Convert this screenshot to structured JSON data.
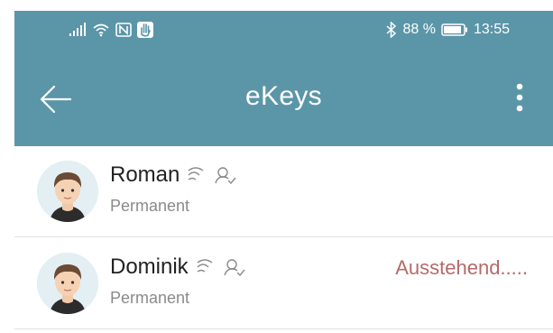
{
  "status_bar": {
    "battery_percent": "88 %",
    "time": "13:55",
    "icons": [
      "signal-icon",
      "wifi-icon",
      "nfc-icon",
      "hand-icon",
      "bluetooth-icon",
      "battery-icon"
    ]
  },
  "app_bar": {
    "title": "eKeys",
    "back_icon": "arrow-left-icon",
    "menu_icon": "more-vertical-icon",
    "color": "#5b96a8"
  },
  "keys": [
    {
      "name": "Roman",
      "type": "Permanent",
      "status": ""
    },
    {
      "name": "Dominik",
      "type": "Permanent",
      "status": "Ausstehend....."
    }
  ],
  "colors": {
    "pending": "#b56a6a",
    "subtext": "#8a8a8a"
  }
}
